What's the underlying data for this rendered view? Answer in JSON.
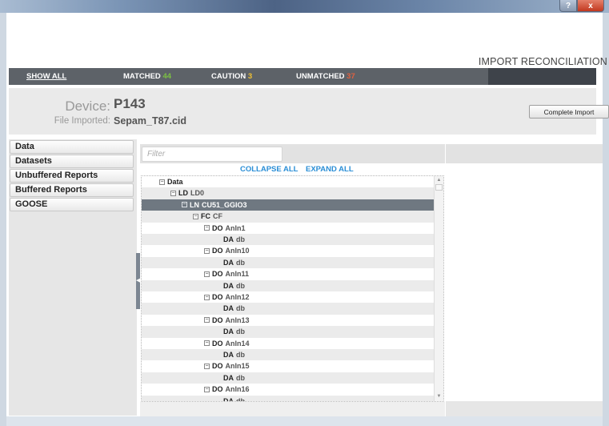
{
  "window": {
    "help_glyph": "?",
    "close_glyph": "x"
  },
  "header": {
    "title": "IMPORT RECONCILIATION"
  },
  "tabs": {
    "show_all": "SHOW ALL",
    "matched": "MATCHED",
    "matched_count": "44",
    "caution": "CAUTION",
    "caution_count": "3",
    "unmatched": "UNMATCHED",
    "unmatched_count": "37"
  },
  "device": {
    "device_label": "Device:",
    "device_value": "P143",
    "file_label": "File Imported:",
    "file_value": "Sepam_T87.cid",
    "complete_button": "Complete Import"
  },
  "nav": {
    "items": [
      "Data",
      "Datasets",
      "Unbuffered Reports",
      "Buffered Reports",
      "GOOSE"
    ]
  },
  "filter": {
    "placeholder": "Filter"
  },
  "tree_actions": {
    "collapse_all": "COLLAPSE ALL",
    "expand_all": "EXPAND ALL"
  },
  "tree": {
    "toggle_glyph": "−",
    "rows": [
      {
        "depth": 0,
        "toggle": true,
        "type": "",
        "name": "Data"
      },
      {
        "depth": 1,
        "toggle": true,
        "type": "LD",
        "name": "LD0"
      },
      {
        "depth": 2,
        "toggle": true,
        "type": "LN",
        "name": "CU51_GGIO3",
        "selected": true
      },
      {
        "depth": 3,
        "toggle": true,
        "type": "FC",
        "name": "CF"
      },
      {
        "depth": 4,
        "toggle": true,
        "type": "DO",
        "name": "AnIn1"
      },
      {
        "depth": 5,
        "toggle": false,
        "type": "DA",
        "name": "db"
      },
      {
        "depth": 4,
        "toggle": true,
        "type": "DO",
        "name": "AnIn10"
      },
      {
        "depth": 5,
        "toggle": false,
        "type": "DA",
        "name": "db"
      },
      {
        "depth": 4,
        "toggle": true,
        "type": "DO",
        "name": "AnIn11"
      },
      {
        "depth": 5,
        "toggle": false,
        "type": "DA",
        "name": "db"
      },
      {
        "depth": 4,
        "toggle": true,
        "type": "DO",
        "name": "AnIn12"
      },
      {
        "depth": 5,
        "toggle": false,
        "type": "DA",
        "name": "db"
      },
      {
        "depth": 4,
        "toggle": true,
        "type": "DO",
        "name": "AnIn13"
      },
      {
        "depth": 5,
        "toggle": false,
        "type": "DA",
        "name": "db"
      },
      {
        "depth": 4,
        "toggle": true,
        "type": "DO",
        "name": "AnIn14"
      },
      {
        "depth": 5,
        "toggle": false,
        "type": "DA",
        "name": "db"
      },
      {
        "depth": 4,
        "toggle": true,
        "type": "DO",
        "name": "AnIn15"
      },
      {
        "depth": 5,
        "toggle": false,
        "type": "DA",
        "name": "db"
      },
      {
        "depth": 4,
        "toggle": true,
        "type": "DO",
        "name": "AnIn16"
      },
      {
        "depth": 5,
        "toggle": false,
        "type": "DA",
        "name": "db"
      }
    ]
  },
  "scroll_glyphs": {
    "up": "▲",
    "down": "▼",
    "splitter": "◀"
  },
  "colors": {
    "matched": "#7cc142",
    "caution": "#f1c232",
    "unmatched": "#e06040",
    "link": "#2a8ed6",
    "selected_row": "#6f7881"
  }
}
